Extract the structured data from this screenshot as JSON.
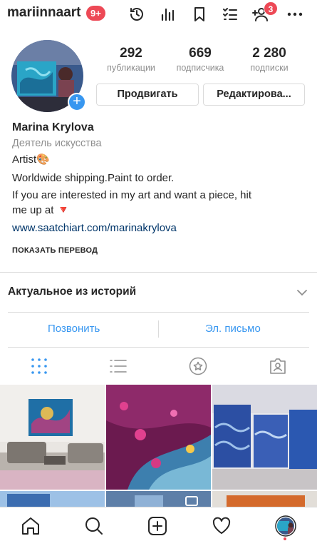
{
  "topbar": {
    "username": "mariinnaart",
    "notification_badge": "9+",
    "friend_requests_badge": "3",
    "icons": [
      "history-icon",
      "insights-icon",
      "bookmark-icon",
      "list-icon",
      "add-friend-icon",
      "more-icon"
    ]
  },
  "profile": {
    "stats": [
      {
        "value": "292",
        "label": "публикации"
      },
      {
        "value": "669",
        "label": "подписчика"
      },
      {
        "value": "2 280",
        "label": "подписки"
      }
    ],
    "promote_label": "Продвигать",
    "edit_label": "Редактирова...",
    "name": "Marina Krylova",
    "category": "Деятель искусства",
    "bio": {
      "line1": "Artist🎨",
      "line2": "Worldwide shipping.Paint to order.",
      "line3": "If you are interested in my art and want a piece, hit",
      "line4": "me up at 🔻"
    },
    "website": "www.saatchiart.com/marinakrylova",
    "translate_label": "ПОКАЗАТЬ ПЕРЕВОД"
  },
  "highlights": {
    "title": "Актуальное из историй"
  },
  "contact": {
    "call_label": "Позвонить",
    "email_label": "Эл. письмо"
  },
  "tabs": [
    "grid-icon",
    "feed-list-icon",
    "star-icon",
    "tagged-icon"
  ],
  "colors": {
    "accent": "#3897f0",
    "badge": "#ed4956",
    "muted": "#8e8e8e",
    "link": "#003569",
    "border": "#dbdbdb"
  }
}
